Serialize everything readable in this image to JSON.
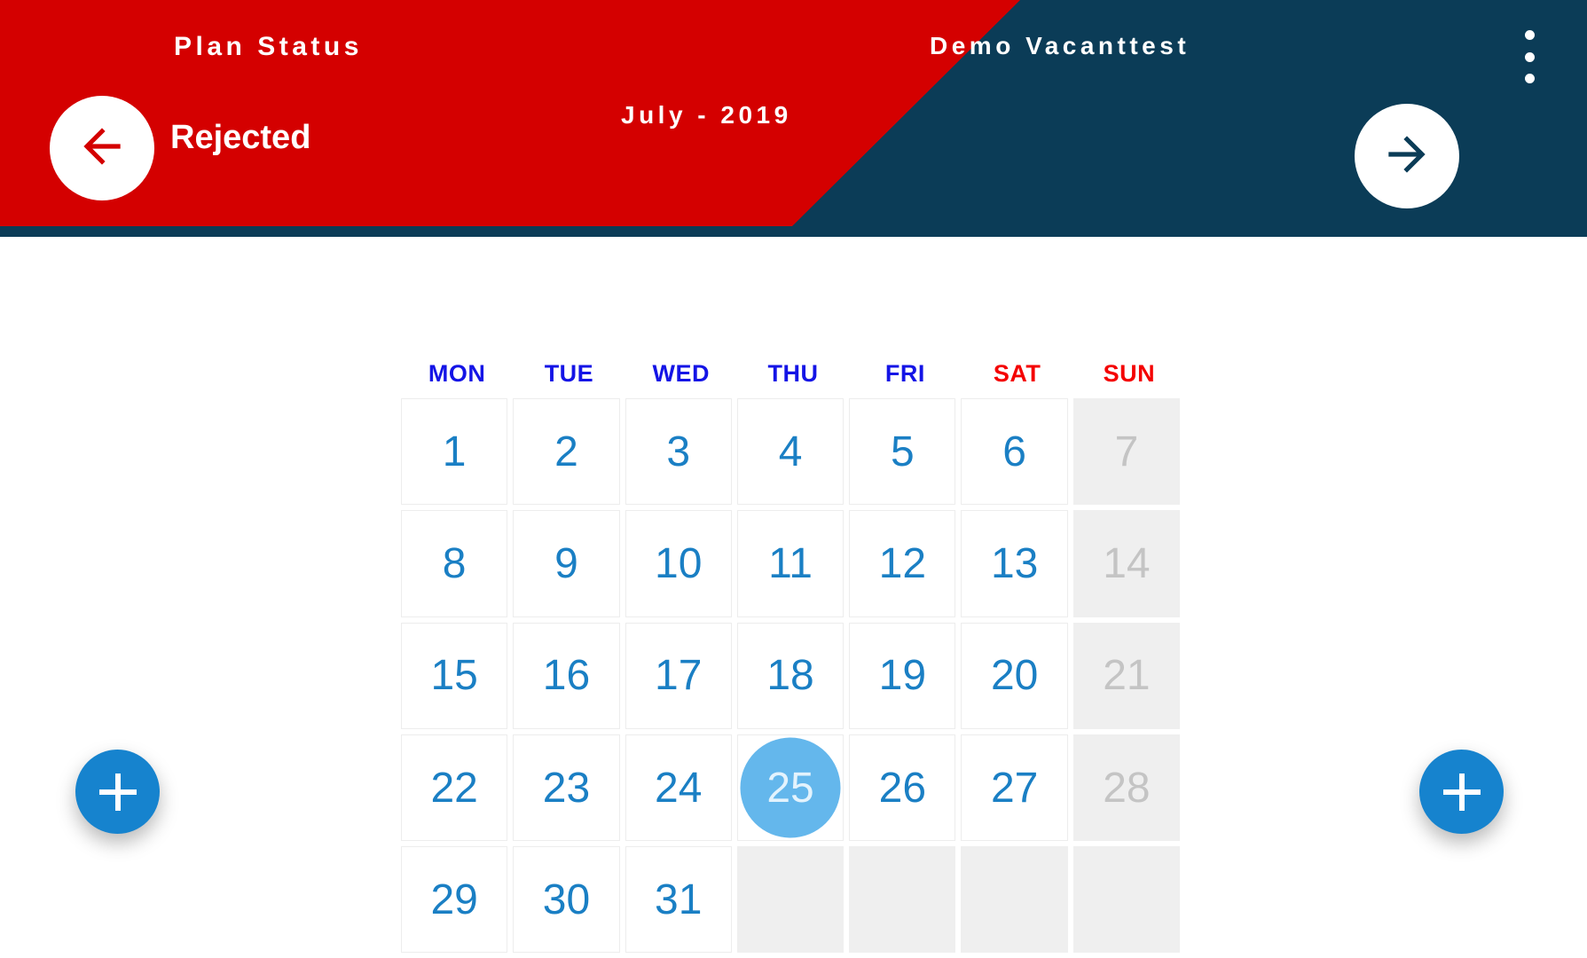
{
  "header": {
    "plan_status_label": "Plan Status",
    "plan_status_value": "Rejected",
    "month_label": "July - 2019",
    "account_label": "Demo  Vacanttest",
    "prev_icon": "arrow-left-icon",
    "next_icon": "arrow-right-icon",
    "overflow_icon": "kebab-menu-icon",
    "red": "#d40000",
    "navy": "#0b3c57"
  },
  "calendar": {
    "weekdays": [
      {
        "label": "MON",
        "weekend": false
      },
      {
        "label": "TUE",
        "weekend": false
      },
      {
        "label": "WED",
        "weekend": false
      },
      {
        "label": "THU",
        "weekend": false
      },
      {
        "label": "FRI",
        "weekend": false
      },
      {
        "label": "SAT",
        "weekend": true
      },
      {
        "label": "SUN",
        "weekend": true
      }
    ],
    "selected_day": "25",
    "accent": "#1a7fc4",
    "selected_bg": "#64b7ec",
    "muted_bg": "#efefef",
    "weekday_color": "#1414e6",
    "weekend_color": "#f40000",
    "weeks": [
      [
        {
          "label": "1",
          "muted": false
        },
        {
          "label": "2",
          "muted": false
        },
        {
          "label": "3",
          "muted": false
        },
        {
          "label": "4",
          "muted": false
        },
        {
          "label": "5",
          "muted": false
        },
        {
          "label": "6",
          "muted": false
        },
        {
          "label": "7",
          "muted": true
        }
      ],
      [
        {
          "label": "8",
          "muted": false
        },
        {
          "label": "9",
          "muted": false
        },
        {
          "label": "10",
          "muted": false
        },
        {
          "label": "11",
          "muted": false
        },
        {
          "label": "12",
          "muted": false
        },
        {
          "label": "13",
          "muted": false
        },
        {
          "label": "14",
          "muted": true
        }
      ],
      [
        {
          "label": "15",
          "muted": false
        },
        {
          "label": "16",
          "muted": false
        },
        {
          "label": "17",
          "muted": false
        },
        {
          "label": "18",
          "muted": false
        },
        {
          "label": "19",
          "muted": false
        },
        {
          "label": "20",
          "muted": false
        },
        {
          "label": "21",
          "muted": true
        }
      ],
      [
        {
          "label": "22",
          "muted": false
        },
        {
          "label": "23",
          "muted": false
        },
        {
          "label": "24",
          "muted": false
        },
        {
          "label": "25",
          "muted": false,
          "selected": true
        },
        {
          "label": "26",
          "muted": false
        },
        {
          "label": "27",
          "muted": false
        },
        {
          "label": "28",
          "muted": true
        }
      ],
      [
        {
          "label": "29",
          "muted": false
        },
        {
          "label": "30",
          "muted": false
        },
        {
          "label": "31",
          "muted": false
        },
        {
          "label": "",
          "muted": true
        },
        {
          "label": "",
          "muted": true
        },
        {
          "label": "",
          "muted": true
        },
        {
          "label": "",
          "muted": true
        }
      ]
    ]
  },
  "fabs": {
    "left_label": "+",
    "right_label": "+",
    "color": "#1683ce"
  }
}
